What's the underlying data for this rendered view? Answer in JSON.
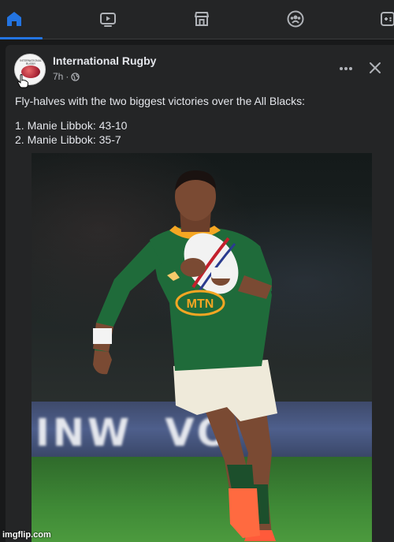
{
  "nav": {
    "tabs": [
      {
        "icon": "home-icon",
        "active": true
      },
      {
        "icon": "video-icon",
        "active": false
      },
      {
        "icon": "marketplace-icon",
        "active": false
      },
      {
        "icon": "groups-icon",
        "active": false
      },
      {
        "icon": "gaming-icon",
        "active": false
      }
    ],
    "accent_color": "#2374e1"
  },
  "post": {
    "page_name": "International Rugby",
    "time": "7h",
    "separator": "·",
    "text_line_1": "Fly-halves with the two biggest victories over the All Blacks:",
    "list_item_1": "1. Manie Libbok: 43-10",
    "list_item_2": "2. Manie Libbok: 35-7",
    "photo": {
      "jersey_sponsor": "MTN",
      "jersey_color": "#1f6b3a",
      "collar_color": "#f5a623"
    }
  },
  "watermark": "imgflip.com"
}
